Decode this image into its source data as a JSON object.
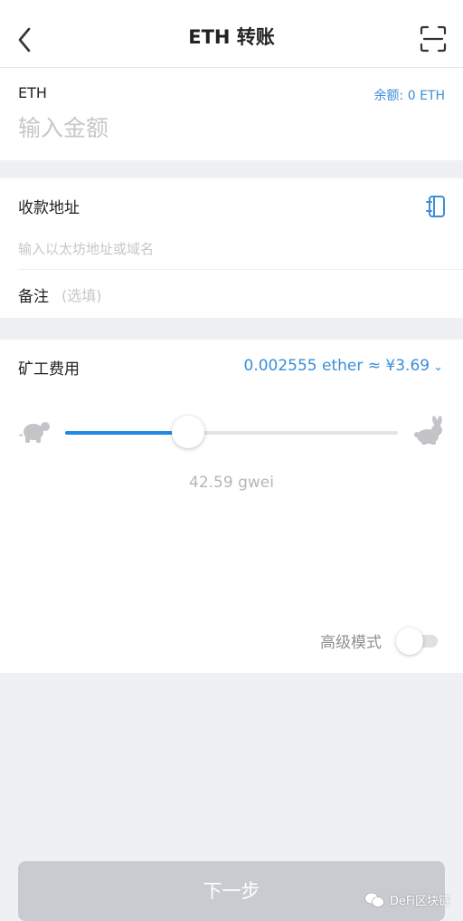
{
  "header": {
    "title": "ETH 转账"
  },
  "amount": {
    "token_symbol": "ETH",
    "balance_text": "余额: 0 ETH",
    "placeholder": "输入金额"
  },
  "recipient": {
    "label": "收款地址",
    "placeholder": "输入以太坊地址或域名",
    "memo_label": "备注",
    "memo_placeholder": "(选填)"
  },
  "fee": {
    "label": "矿工费用",
    "value_text": "0.002555 ether ≈ ¥3.69",
    "slider_fraction": 0.37,
    "gas_text": "42.59 gwei",
    "advanced_label": "高级模式",
    "advanced_enabled": false
  },
  "footer": {
    "next_label": "下一步"
  },
  "watermark": {
    "text": "DeFi区块链"
  },
  "icons": {
    "back": "chevron-left-icon",
    "scan": "scan-icon",
    "address_book": "address-book-icon",
    "slow": "turtle-icon",
    "fast": "rabbit-icon"
  },
  "colors": {
    "accent": "#1f8ae3",
    "link": "#3a8fd8",
    "button_disabled": "#c9cbd0"
  }
}
